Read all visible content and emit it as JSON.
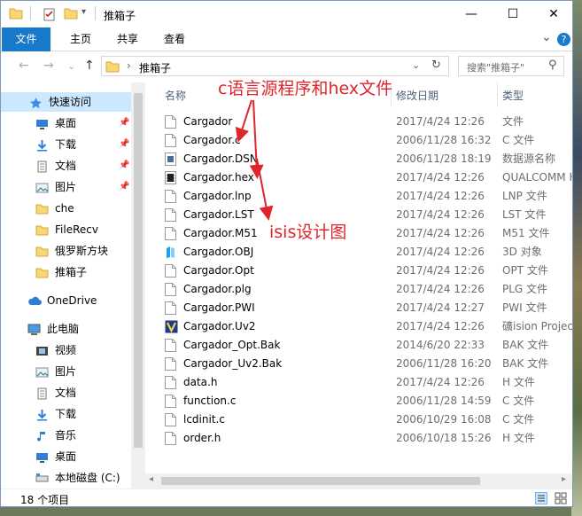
{
  "window": {
    "title": "推箱子",
    "minimize": "—",
    "maximize": "☐",
    "close": "✕"
  },
  "ribbon": {
    "tabs": [
      "文件",
      "主页",
      "共享",
      "查看"
    ],
    "expand": "⌄",
    "help": "?"
  },
  "nav": {
    "back": "←",
    "forward": "→",
    "history": "⌄",
    "up": "↑",
    "address": "推箱子",
    "address_sep": "›",
    "search_placeholder": "搜索\"推箱子\"",
    "search_glyph": "⚲",
    "refresh": "↻",
    "dropdown": "⌄"
  },
  "sidebar": {
    "items": [
      {
        "label": "快速访问",
        "icon": "star-icon",
        "pinned": false
      },
      {
        "label": "桌面",
        "icon": "desktop-icon",
        "pinned": true
      },
      {
        "label": "下载",
        "icon": "download-icon",
        "pinned": true
      },
      {
        "label": "文档",
        "icon": "document-icon",
        "pinned": true
      },
      {
        "label": "图片",
        "icon": "picture-icon",
        "pinned": true
      },
      {
        "label": "che",
        "icon": "folder-icon",
        "pinned": false
      },
      {
        "label": "FileRecv",
        "icon": "folder-icon",
        "pinned": false
      },
      {
        "label": "俄罗斯方块",
        "icon": "folder-icon",
        "pinned": false
      },
      {
        "label": "推箱子",
        "icon": "folder-icon",
        "pinned": false
      },
      {
        "label": "OneDrive",
        "icon": "cloud-icon",
        "pinned": false
      },
      {
        "label": "此电脑",
        "icon": "computer-icon",
        "pinned": false
      },
      {
        "label": "视频",
        "icon": "video-icon",
        "pinned": false
      },
      {
        "label": "图片",
        "icon": "picture-icon",
        "pinned": false
      },
      {
        "label": "文档",
        "icon": "document-icon",
        "pinned": false
      },
      {
        "label": "下载",
        "icon": "download-icon",
        "pinned": false
      },
      {
        "label": "音乐",
        "icon": "music-icon",
        "pinned": false
      },
      {
        "label": "桌面",
        "icon": "desktop-icon",
        "pinned": false
      },
      {
        "label": "本地磁盘 (C:)",
        "icon": "drive-icon",
        "pinned": false
      }
    ],
    "pin_glyph": "📌"
  },
  "columns": {
    "name": "名称",
    "date": "修改日期",
    "type": "类型"
  },
  "files": [
    {
      "name": "Cargador",
      "date": "2017/4/24 12:26",
      "type": "文件",
      "icon": "file-icon"
    },
    {
      "name": "Cargador.c",
      "date": "2006/11/28 16:32",
      "type": "C 文件",
      "icon": "file-icon"
    },
    {
      "name": "Cargador.DSN",
      "date": "2006/11/28 18:19",
      "type": "数据源名称",
      "icon": "dsn-file-icon"
    },
    {
      "name": "Cargador.hex",
      "date": "2017/4/24 12:26",
      "type": "QUALCOMM H",
      "icon": "hex-file-icon"
    },
    {
      "name": "Cargador.lnp",
      "date": "2017/4/24 12:26",
      "type": "LNP 文件",
      "icon": "file-icon"
    },
    {
      "name": "Cargador.LST",
      "date": "2017/4/24 12:26",
      "type": "LST 文件",
      "icon": "file-icon"
    },
    {
      "name": "Cargador.M51",
      "date": "2017/4/24 12:26",
      "type": "M51 文件",
      "icon": "file-icon"
    },
    {
      "name": "Cargador.OBJ",
      "date": "2017/4/24 12:26",
      "type": "3D 对象",
      "icon": "3d-object-icon"
    },
    {
      "name": "Cargador.Opt",
      "date": "2017/4/24 12:26",
      "type": "OPT 文件",
      "icon": "file-icon"
    },
    {
      "name": "Cargador.plg",
      "date": "2017/4/24 12:26",
      "type": "PLG 文件",
      "icon": "file-icon"
    },
    {
      "name": "Cargador.PWI",
      "date": "2017/4/24 12:27",
      "type": "PWI 文件",
      "icon": "file-icon"
    },
    {
      "name": "Cargador.Uv2",
      "date": "2017/4/24 12:26",
      "type": "礦ision Project",
      "icon": "uvision-icon"
    },
    {
      "name": "Cargador_Opt.Bak",
      "date": "2014/6/20 22:33",
      "type": "BAK 文件",
      "icon": "file-icon"
    },
    {
      "name": "Cargador_Uv2.Bak",
      "date": "2006/11/28 16:20",
      "type": "BAK 文件",
      "icon": "file-icon"
    },
    {
      "name": "data.h",
      "date": "2017/4/24 12:26",
      "type": "H 文件",
      "icon": "file-icon"
    },
    {
      "name": "function.c",
      "date": "2006/11/28 14:59",
      "type": "C 文件",
      "icon": "file-icon"
    },
    {
      "name": "lcdinit.c",
      "date": "2006/10/29 16:08",
      "type": "C 文件",
      "icon": "file-icon"
    },
    {
      "name": "order.h",
      "date": "2006/10/18 15:26",
      "type": "H 文件",
      "icon": "file-icon"
    }
  ],
  "status": {
    "count": "18 个项目"
  },
  "annotations": {
    "source_hex": "c语言源程序和hex文件",
    "isis": "isis设计图"
  },
  "colors": {
    "accent": "#1979ca",
    "selection": "#cce8ff",
    "annotation": "#e0242c",
    "folder": "#f8d775"
  }
}
